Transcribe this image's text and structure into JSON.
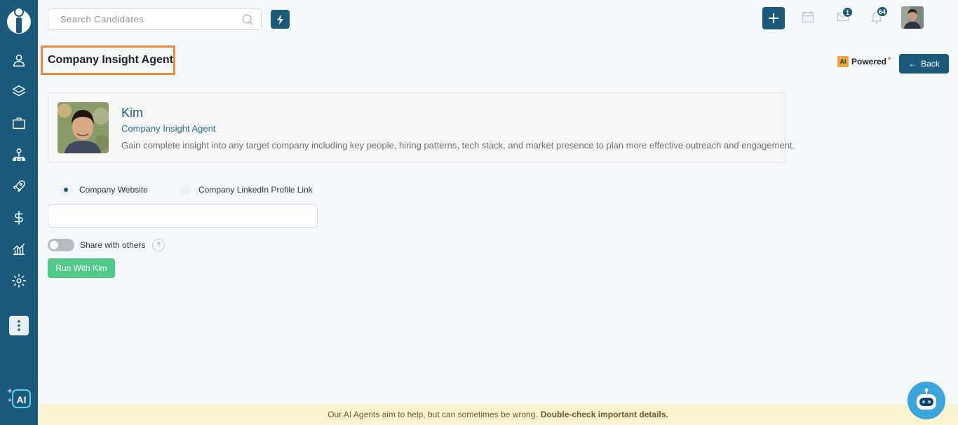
{
  "colors": {
    "brand": "#1b5a7a",
    "accent": "#f0893f",
    "success": "#52c98a",
    "disclaimer_bg": "#fbf3cf"
  },
  "sidebar": {
    "items": [
      {
        "icon": "user-icon"
      },
      {
        "icon": "layers-icon"
      },
      {
        "icon": "briefcase-icon"
      },
      {
        "icon": "org-chart-icon"
      },
      {
        "icon": "rocket-icon"
      },
      {
        "icon": "dollar-icon"
      },
      {
        "icon": "analytics-icon"
      },
      {
        "icon": "gear-icon"
      }
    ],
    "more_icon": "more-vertical-icon",
    "ai_badge": "AI"
  },
  "topbar": {
    "search_placeholder": "Search Candidates",
    "mail_count": "1",
    "notification_count": "64"
  },
  "page": {
    "title": "Company Insight Agent",
    "powered_chip": "AI",
    "powered_label": "Powered",
    "back_label": "Back"
  },
  "agent": {
    "name": "Kim",
    "role": "Company Insight Agent",
    "description": "Gain complete insight into any target company including key people, hiring patterns, tech stack, and market presence to plan more effective outreach and engagement."
  },
  "form": {
    "options": [
      {
        "label": "Company Website",
        "selected": true
      },
      {
        "label": "Company LinkedIn Profile Link",
        "selected": false
      }
    ],
    "input_value": "",
    "share_label": "Share with others",
    "share_enabled": false,
    "help": "?",
    "run_label": "Run With Kim"
  },
  "footer": {
    "disclaimer": "Our AI Agents aim to help, but can sometimes be wrong.",
    "disclaimer_bold": "Double-check important details."
  }
}
